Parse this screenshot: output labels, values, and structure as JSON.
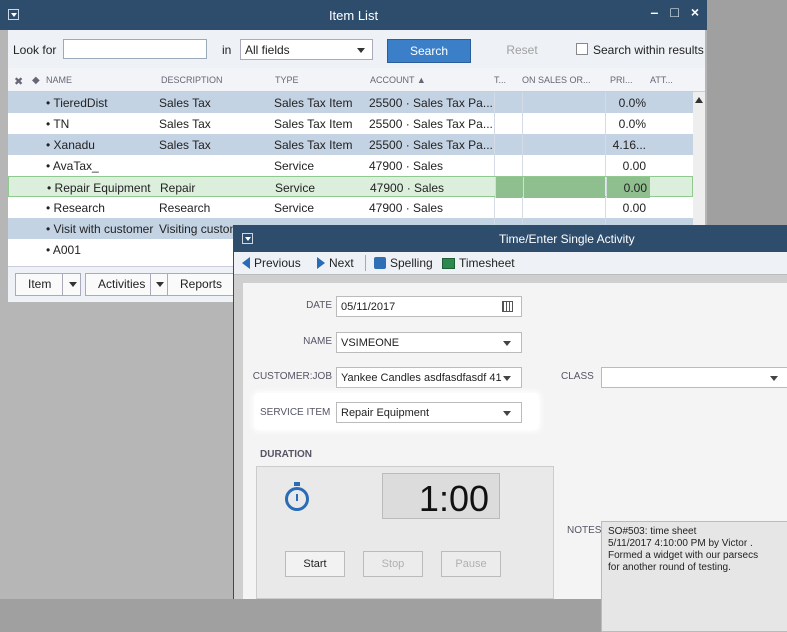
{
  "item_list": {
    "title": "Item List",
    "window_controls": {
      "minimize": "–",
      "restore": "□",
      "close": "×"
    },
    "toolbar": {
      "look_for_label": "Look for",
      "look_for_value": "",
      "in_label": "in",
      "fields_selected": "All fields",
      "search_label": "Search",
      "reset_label": "Reset",
      "search_within_label": "Search within results"
    },
    "columns": [
      "NAME",
      "DESCRIPTION",
      "TYPE",
      "ACCOUNT ▲",
      "T...",
      "ON SALES OR...",
      "PRI...",
      "ATT..."
    ],
    "header_icons": {
      "delete": "✖",
      "diamond": "◆"
    },
    "rows": [
      {
        "name": "TieredDist",
        "description": "Sales Tax",
        "type": "Sales Tax Item",
        "account": "25500 · Sales Tax Pa...",
        "price": "0.0%"
      },
      {
        "name": "TN",
        "description": "Sales Tax",
        "type": "Sales Tax Item",
        "account": "25500 · Sales Tax Pa...",
        "price": "0.0%"
      },
      {
        "name": "Xanadu",
        "description": "Sales Tax",
        "type": "Sales Tax Item",
        "account": "25500 · Sales Tax Pa...",
        "price": "4.16..."
      },
      {
        "name": "AvaTax_",
        "description": "",
        "type": "Service",
        "account": "47900 · Sales",
        "price": "0.00"
      },
      {
        "name": "Repair Equipment",
        "description": "Repair",
        "type": "Service",
        "account": "47900 · Sales",
        "price": "0.00"
      },
      {
        "name": "Research",
        "description": "Research",
        "type": "Service",
        "account": "47900 · Sales",
        "price": "0.00"
      },
      {
        "name": "Visit with customer",
        "description": "Visiting customer",
        "type": "",
        "account": "",
        "price": ""
      },
      {
        "name": "A001",
        "description": "",
        "type": "",
        "account": "",
        "price": ""
      }
    ],
    "bottom_buttons": {
      "item": "Item",
      "activities": "Activities",
      "reports": "Reports"
    }
  },
  "time_window": {
    "title": "Time/Enter Single Activity",
    "toolbar": {
      "previous": "Previous",
      "next": "Next",
      "spelling": "Spelling",
      "timesheet": "Timesheet"
    },
    "form": {
      "date_label": "DATE",
      "date_value": "05/11/2017",
      "name_label": "NAME",
      "name_value": "VSIMEONE",
      "customer_label": "CUSTOMER:JOB",
      "customer_value": "Yankee Candles asdfasdfasdf 41",
      "class_label": "CLASS",
      "class_value": "",
      "service_label": "SERVICE ITEM",
      "service_value": "Repair Equipment",
      "duration_label": "DURATION",
      "timer": "1:00",
      "start": "Start",
      "stop": "Stop",
      "pause": "Pause",
      "notes_label": "NOTES",
      "notes": "SO#503: time sheet\n5/11/2017 4:10:00 PM by Victor .\nFormed a widget with our parsecs\nfor another round of testing."
    }
  }
}
